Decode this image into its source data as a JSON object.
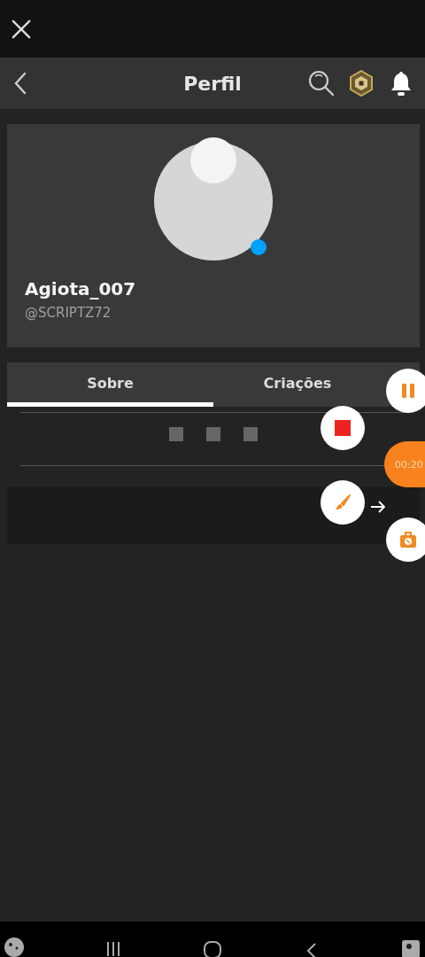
{
  "header": {
    "title": "Perfil"
  },
  "profile": {
    "display_name": "Agiota_007",
    "username": "@SCRIPTZ72",
    "online": true
  },
  "tabs": [
    {
      "label": "Sobre",
      "selected": true
    },
    {
      "label": "Criações",
      "selected": false
    }
  ],
  "recorder": {
    "timer": "00:20"
  }
}
